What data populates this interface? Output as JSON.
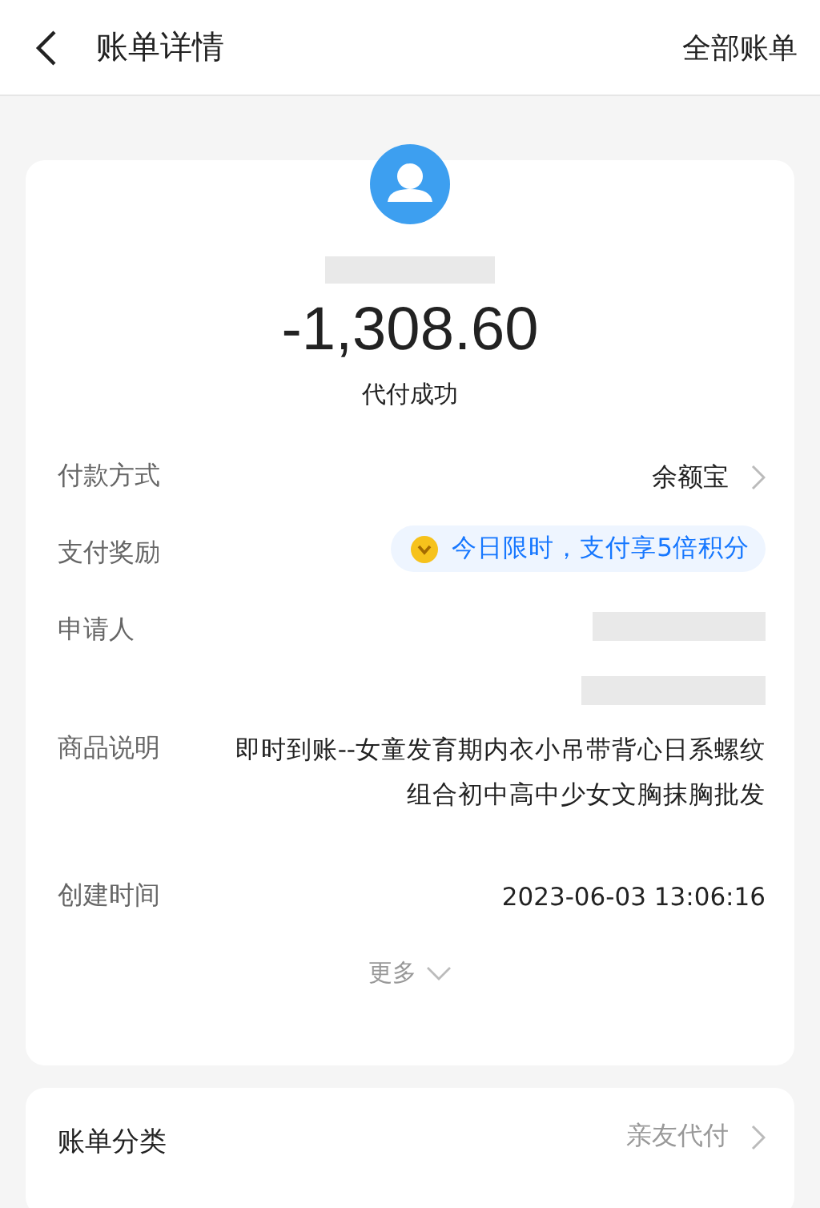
{
  "header": {
    "title": "账单详情",
    "action": "全部账单"
  },
  "summary": {
    "amount": "-1,308.60",
    "status": "代付成功"
  },
  "rows": [
    {
      "kind": "link",
      "label": "付款方式",
      "value": "余额宝"
    },
    {
      "kind": "badge",
      "label": "支付奖励",
      "value": "今日限时，支付享5倍积分"
    },
    {
      "kind": "redacted",
      "label": "申请人"
    },
    {
      "kind": "text",
      "label": "商品说明",
      "value": "即时到账--女童发育期内衣小吊带背心日系螺纹组合初中高中少女文胸抹胸批发"
    },
    {
      "kind": "text",
      "label": "创建时间",
      "value": "2023-06-03 13:06:16"
    }
  ],
  "more": "更多",
  "category": {
    "label": "账单分类",
    "value": "亲友代付"
  }
}
